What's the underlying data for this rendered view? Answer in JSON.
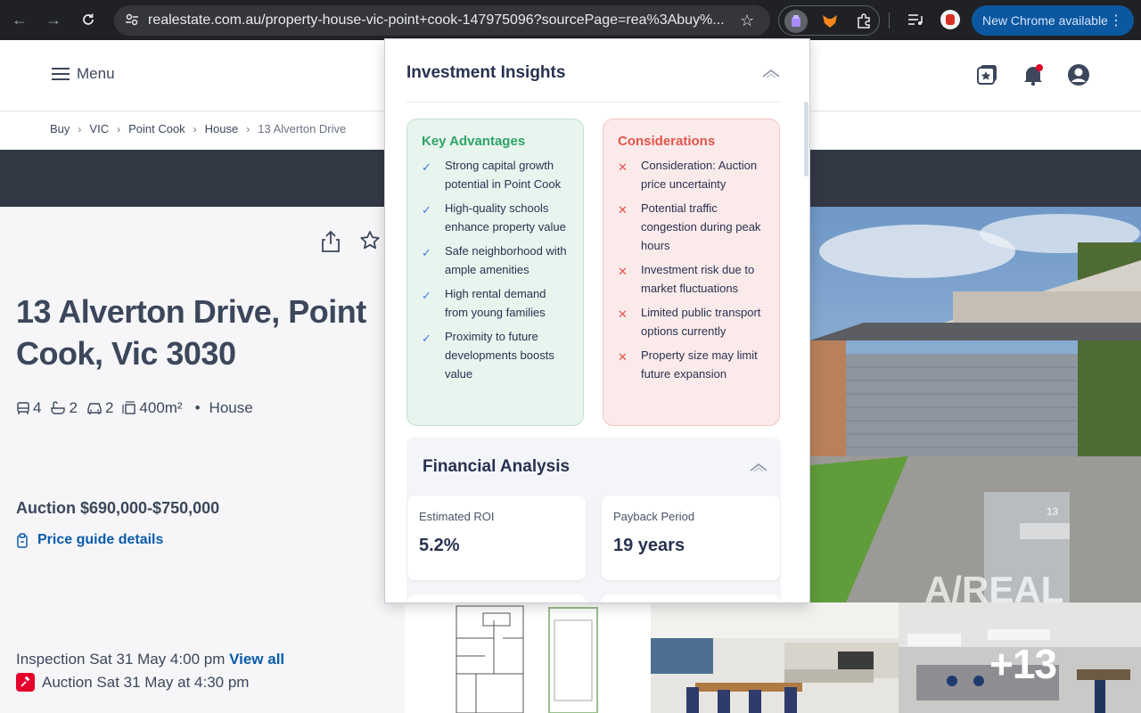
{
  "browser": {
    "url": "realestate.com.au/property-house-vic-point+cook-147975096?sourcePage=rea%3Abuy%...",
    "new_chrome_label": "New Chrome available"
  },
  "header": {
    "menu_label": "Menu"
  },
  "breadcrumb": [
    "Buy",
    "VIC",
    "Point Cook",
    "House",
    "13 Alverton Drive"
  ],
  "property": {
    "title": "13 Alverton Drive, Point Cook, Vic 3030",
    "bedrooms": "4",
    "bathrooms": "2",
    "parking": "2",
    "land_size": "400m²",
    "separator": "•",
    "type": "House",
    "price": "Auction $690,000-$750,000",
    "price_guide_link": "Price guide details",
    "inspection_text": "Inspection Sat 31 May 4:00 pm",
    "view_all": "View all",
    "auction_text": "Auction Sat 31 May at 4:30 pm",
    "more_photos": "+13",
    "hero_house_number": "13",
    "watermark": "A/REAL"
  },
  "popup": {
    "insights_title": "Investment Insights",
    "advantages_title": "Key Advantages",
    "advantages": [
      "Strong capital growth potential in Point Cook",
      "High-quality schools enhance property value",
      "Safe neighborhood with ample amenities",
      "High rental demand from young families",
      "Proximity to future developments boosts value"
    ],
    "considerations_title": "Considerations",
    "considerations": [
      "Consideration: Auction price uncertainty",
      "Potential traffic congestion during peak hours",
      "Investment risk due to market fluctuations",
      "Limited public transport options currently",
      "Property size may limit future expansion"
    ],
    "financial_title": "Financial Analysis",
    "roi_label": "Estimated ROI",
    "roi_value": "5.2%",
    "payback_label": "Payback Period",
    "payback_value": "19 years"
  },
  "colors": {
    "chrome_dark": "#202124",
    "brand_blue": "#0b5cab",
    "text_dark": "#3c475b",
    "advantage_green": "#2ea266",
    "consideration_red": "#e0554c",
    "auction_red": "#e4002b"
  },
  "icons": {
    "check": "✓",
    "cross": "✕"
  }
}
